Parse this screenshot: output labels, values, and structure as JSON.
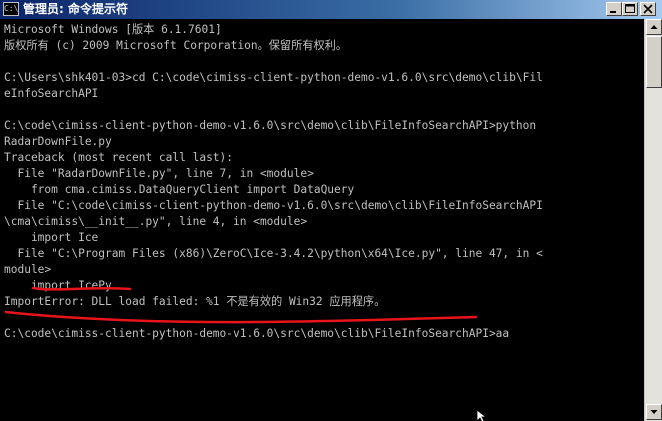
{
  "window": {
    "title": "管理员: 命令提示符",
    "icon_name": "cmd-icon",
    "title_gradient": [
      "#0a246a",
      "#a6caf0"
    ],
    "console_bg": "#000000",
    "console_fg": "#c0c0c0",
    "annotation_color": "#e8141a"
  },
  "console": {
    "lines": [
      "Microsoft Windows [版本 6.1.7601]",
      "版权所有 (c) 2009 Microsoft Corporation。保留所有权利。",
      "",
      "C:\\Users\\shk401-03>cd C:\\code\\cimiss-client-python-demo-v1.6.0\\src\\demo\\clib\\Fil",
      "eInfoSearchAPI",
      "",
      "C:\\code\\cimiss-client-python-demo-v1.6.0\\src\\demo\\clib\\FileInfoSearchAPI>python",
      "RadarDownFile.py",
      "Traceback (most recent call last):",
      "  File \"RadarDownFile.py\", line 7, in <module>",
      "    from cma.cimiss.DataQueryClient import DataQuery",
      "  File \"C:\\code\\cimiss-client-python-demo-v1.6.0\\src\\demo\\clib\\FileInfoSearchAPI",
      "\\cma\\cimiss\\__init__.py\", line 4, in <module>",
      "    import Ice",
      "  File \"C:\\Program Files (x86)\\ZeroC\\Ice-3.4.2\\python\\x64\\Ice.py\", line 47, in <",
      "module>",
      "    import IcePy",
      "ImportError: DLL load failed: %1 不是有效的 Win32 应用程序。",
      "",
      "C:\\code\\cimiss-client-python-demo-v1.6.0\\src\\demo\\clib\\FileInfoSearchAPI>aa"
    ]
  }
}
